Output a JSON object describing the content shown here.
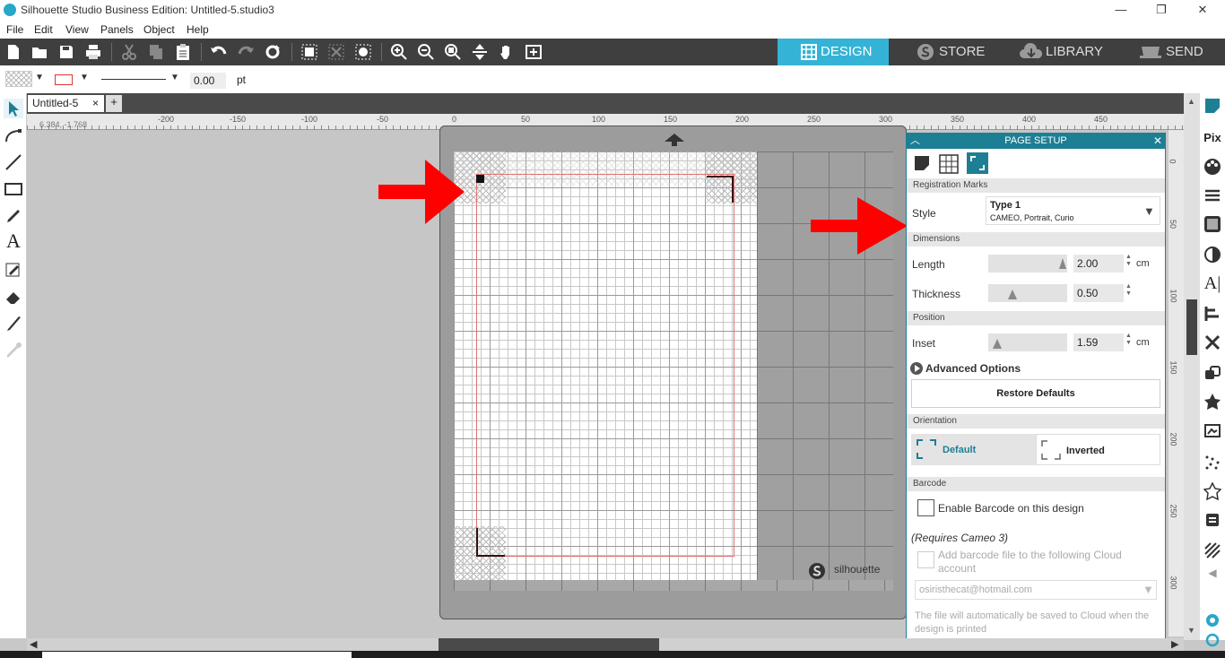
{
  "window": {
    "title": "Silhouette Studio Business Edition: Untitled-5.studio3",
    "controls": [
      "—",
      "❐",
      "✕"
    ]
  },
  "menu": [
    "File",
    "Edit",
    "View",
    "Panels",
    "Object",
    "Help"
  ],
  "nav_tabs": [
    {
      "label": "DESIGN",
      "icon": "grid-icon",
      "active": true
    },
    {
      "label": "STORE",
      "icon": "silhouette-s-icon",
      "active": false
    },
    {
      "label": "LIBRARY",
      "icon": "cloud-download-icon",
      "active": false
    },
    {
      "label": "SEND",
      "icon": "cutter-icon",
      "active": false
    }
  ],
  "propbar": {
    "line_width": "0.00",
    "unit": "pt"
  },
  "doc_tab": {
    "name": "Untitled-5",
    "close": "×",
    "add": "+"
  },
  "coords": "6.384, -1.768",
  "ruler_labels": [
    "-200",
    "-150",
    "-100",
    "-50",
    "0",
    "50",
    "100",
    "150",
    "200",
    "250",
    "300",
    "350",
    "400",
    "450"
  ],
  "vruler_labels": [
    "0",
    "50",
    "100",
    "150",
    "200",
    "250",
    "300"
  ],
  "mat_logo": "silhouette",
  "panel": {
    "title": "PAGE SETUP",
    "sections": {
      "registration": "Registration Marks",
      "dimensions": "Dimensions",
      "position": "Position",
      "orientation": "Orientation",
      "barcode": "Barcode"
    },
    "style_label": "Style",
    "style_value": "Type 1",
    "style_sub": "CAMEO, Portrait, Curio",
    "length_label": "Length",
    "length_value": "2.00",
    "length_unit": "cm",
    "thickness_label": "Thickness",
    "thickness_value": "0.50",
    "inset_label": "Inset",
    "inset_value": "1.59",
    "inset_unit": "cm",
    "advanced": "Advanced Options",
    "restore": "Restore Defaults",
    "orient_default": "Default",
    "orient_inverted": "Inverted",
    "enable_barcode": "Enable Barcode on this design",
    "requires": "(Requires Cameo 3)",
    "add_barcode": "Add barcode file to the following Cloud account",
    "email": "osiristhecat@hotmail.com",
    "autosave": "The file will automatically be saved to Cloud when the design is printed"
  },
  "colors": {
    "toolbar": "#3f3f3f",
    "accent": "#34b3d6",
    "panel_header": "#1d7f94",
    "arrow": "#ff0000"
  }
}
